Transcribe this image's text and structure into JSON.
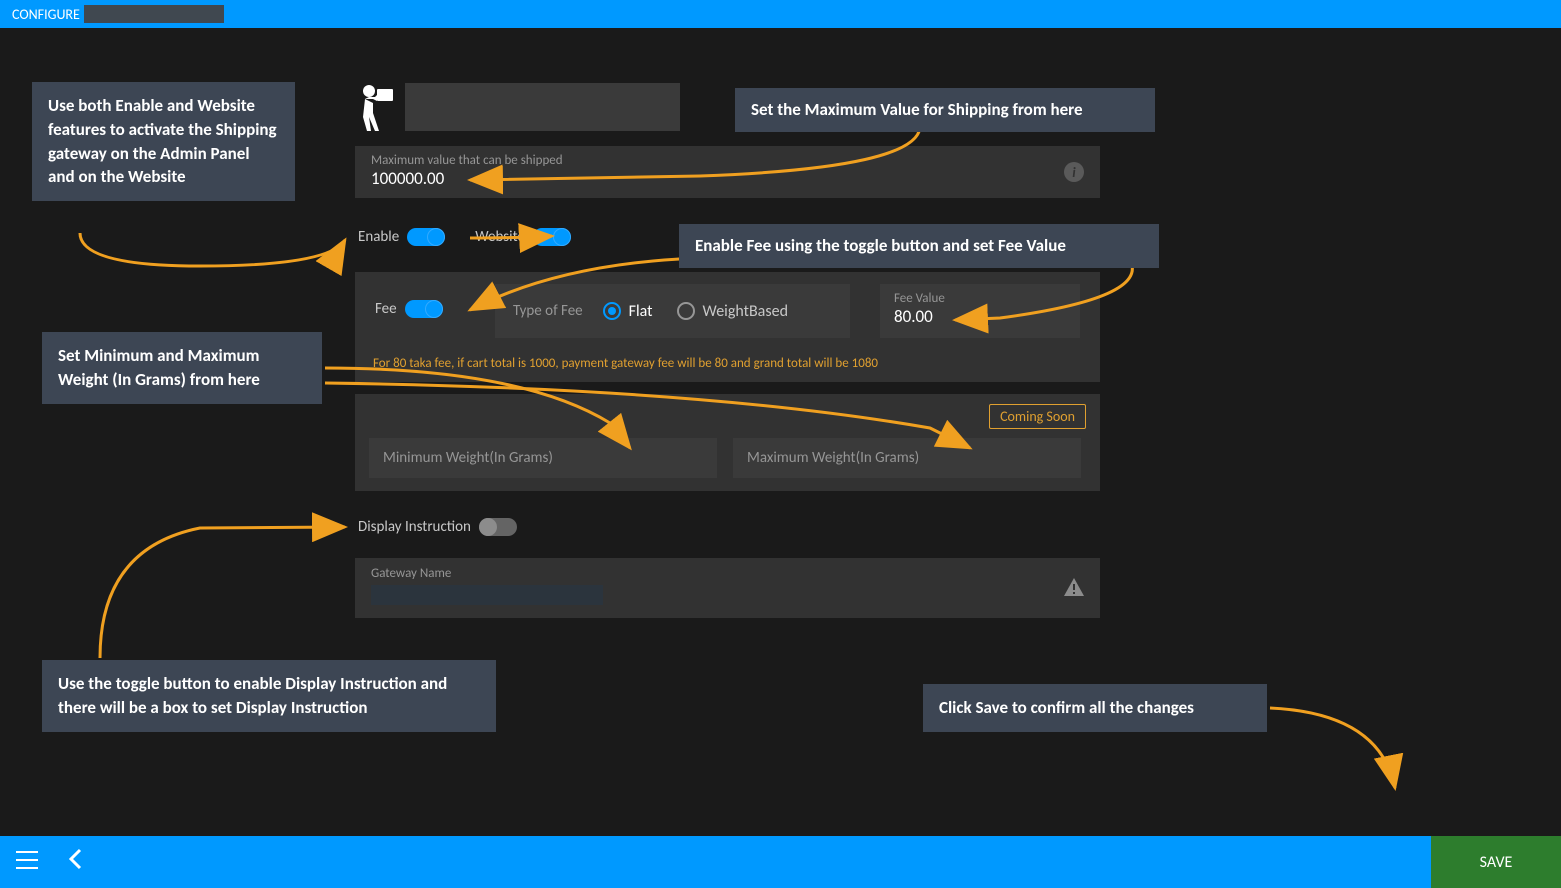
{
  "topbar": {
    "title": "CONFIGURE"
  },
  "callouts": {
    "enableWebsite": "Use both Enable and Website features to activate the Shipping gateway on the Admin Panel and on the Website",
    "maxValue": "Set the Maximum Value for Shipping from here",
    "enableFee": "Enable Fee using the toggle button and set Fee Value",
    "weights": "Set Minimum and Maximum Weight (In Grams) from here",
    "displayInstruction": "Use the toggle button to enable Display Instruction and there will be a box to set Display Instruction",
    "save": "Click Save to confirm all the changes"
  },
  "fields": {
    "maxShipLabel": "Maximum value that can be shipped",
    "maxShipValue": "100000.00",
    "enableLabel": "Enable",
    "websiteLabel": "Website",
    "feeLabel": "Fee",
    "typeOfFeeLabel": "Type of Fee",
    "flatLabel": "Flat",
    "weightBasedLabel": "WeightBased",
    "feeValueLabel": "Fee Value",
    "feeValue": "80.00",
    "feeHelp": "For 80 taka fee, if cart total is 1000, payment gateway fee will be 80 and grand total will be 1080",
    "comingSoon": "Coming Soon",
    "minWeightLabel": "Minimum Weight(In Grams)",
    "maxWeightLabel": "Maximum Weight(In Grams)",
    "displayInstructionLabel": "Display Instruction",
    "gatewayNameLabel": "Gateway Name"
  },
  "footer": {
    "save": "SAVE"
  }
}
